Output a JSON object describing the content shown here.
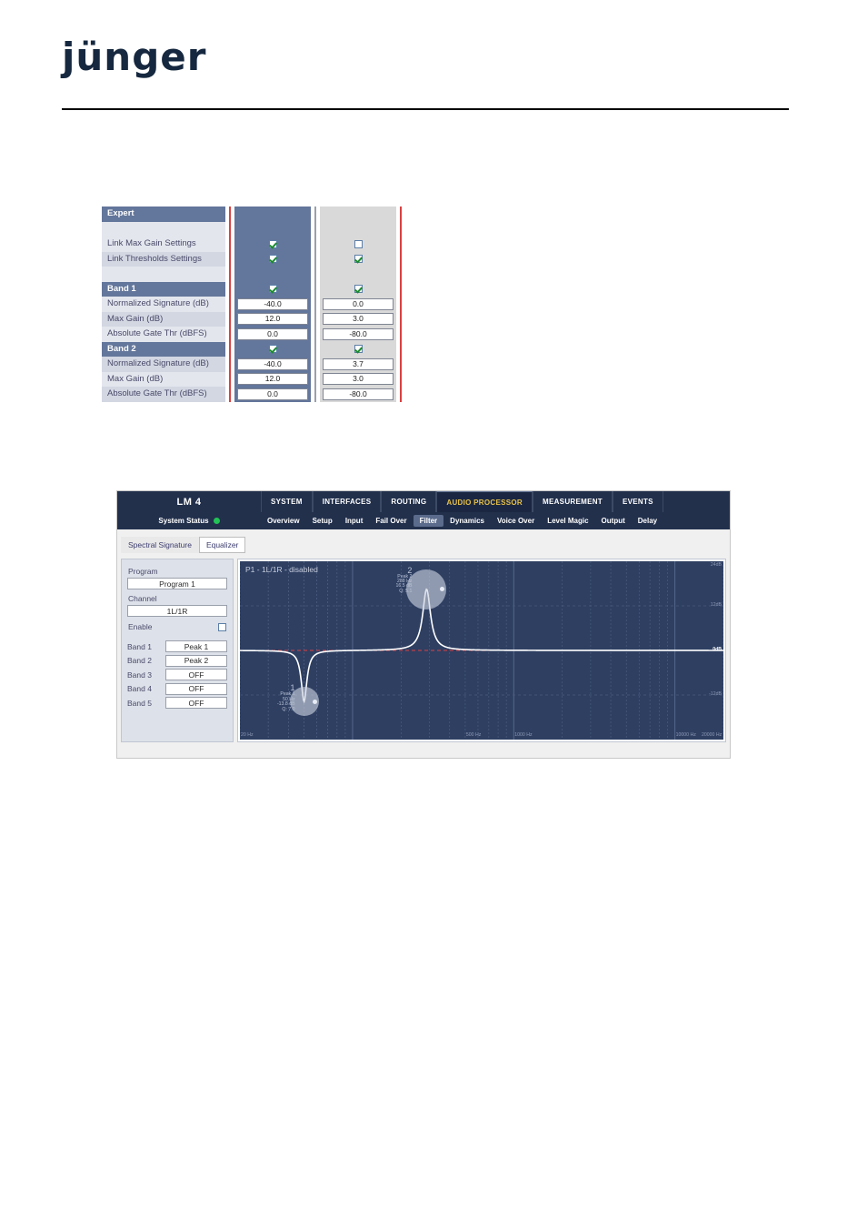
{
  "brand": {
    "logo_text": "jünger"
  },
  "settings_table": {
    "rows": [
      {
        "type": "header",
        "label": "Expert",
        "header_checkbox": true,
        "blue": null,
        "gray": null
      },
      {
        "type": "blank",
        "label": "",
        "blue": null,
        "gray": null
      },
      {
        "type": "check",
        "label": "Link Max Gain Settings",
        "blue": "checked",
        "gray": "unchecked"
      },
      {
        "type": "check",
        "label": "Link Thresholds Settings",
        "blue": "checked",
        "gray": "checked"
      },
      {
        "type": "blank",
        "label": "",
        "blue": null,
        "gray": null
      },
      {
        "type": "header",
        "label": "Band 1",
        "header_checkbox": false,
        "blue": "checked",
        "gray": "checked"
      },
      {
        "type": "value",
        "label": "Normalized Signature (dB)",
        "blue": "-40.0",
        "gray": "0.0"
      },
      {
        "type": "value",
        "label": "Max Gain (dB)",
        "blue": "12.0",
        "gray": "3.0"
      },
      {
        "type": "value",
        "label": "Absolute Gate Thr (dBFS)",
        "blue": "0.0",
        "gray": "-80.0"
      },
      {
        "type": "header",
        "label": "Band 2",
        "header_checkbox": false,
        "blue": "checked",
        "gray": "checked"
      },
      {
        "type": "value",
        "label": "Normalized Signature (dB)",
        "blue": "-40.0",
        "gray": "3.7"
      },
      {
        "type": "value",
        "label": "Max Gain (dB)",
        "blue": "12.0",
        "gray": "3.0"
      },
      {
        "type": "value",
        "label": "Absolute Gate Thr (dBFS)",
        "blue": "0.0",
        "gray": "-80.0"
      }
    ]
  },
  "lm4": {
    "brand": "LM 4",
    "status_label": "System Status",
    "status_color": "#22c455",
    "top_tabs": [
      {
        "label": "SYSTEM",
        "active": false
      },
      {
        "label": "INTERFACES",
        "active": false
      },
      {
        "label": "ROUTING",
        "active": false
      },
      {
        "label": "AUDIO PROCESSOR",
        "active": true
      },
      {
        "label": "MEASUREMENT",
        "active": false
      },
      {
        "label": "EVENTS",
        "active": false
      }
    ],
    "sub_tabs": [
      {
        "label": "Overview",
        "active": false
      },
      {
        "label": "Setup",
        "active": false
      },
      {
        "label": "Input",
        "active": false
      },
      {
        "label": "Fail Over",
        "active": false
      },
      {
        "label": "Filter",
        "active": true
      },
      {
        "label": "Dynamics",
        "active": false
      },
      {
        "label": "Voice Over",
        "active": false
      },
      {
        "label": "Level Magic",
        "active": false
      },
      {
        "label": "Output",
        "active": false
      },
      {
        "label": "Delay",
        "active": false
      }
    ],
    "pills": [
      {
        "label": "Spectral Signature",
        "active": false
      },
      {
        "label": "Equalizer",
        "active": true
      }
    ],
    "panel": {
      "program_label": "Program",
      "program_value": "Program 1",
      "channel_label": "Channel",
      "channel_value": "1L/1R",
      "enable_label": "Enable",
      "enable_checked": false,
      "bands": [
        {
          "name": "Band 1",
          "value": "Peak 1"
        },
        {
          "name": "Band 2",
          "value": "Peak 2"
        },
        {
          "name": "Band 3",
          "value": "OFF"
        },
        {
          "name": "Band 4",
          "value": "OFF"
        },
        {
          "name": "Band 5",
          "value": "OFF"
        }
      ]
    }
  },
  "chart_data": {
    "type": "line",
    "title": "P1 - 1L/1R - disabled",
    "xlabel": "",
    "ylabel": "",
    "xscale": "log",
    "xlim": [
      20,
      20000
    ],
    "ylim": [
      -24,
      24
    ],
    "grid": true,
    "legend": "none",
    "curve_color": "#ffffff",
    "zero_line_color": "#d94141",
    "background": "#2e3f62",
    "x_ticks": [
      "20 Hz",
      "500 Hz",
      "1000 Hz",
      "10000 Hz",
      "20000 Hz"
    ],
    "y_ticks": [
      "24dB",
      "12dB",
      "0dB",
      "-12dB"
    ],
    "markers": [
      {
        "number": "1",
        "type": "Peak 1",
        "freq": "50 Hz",
        "gain": "-13.8 dB",
        "q": "Q: 7.0",
        "freq_hz": 50,
        "gain_db": -13.8,
        "q_value": 7.0
      },
      {
        "number": "2",
        "type": "Peak 2",
        "freq": "288 Hz",
        "gain": "16.5 dB",
        "q": "Q: 5.1",
        "freq_hz": 288,
        "gain_db": 16.5,
        "q_value": 5.1
      }
    ]
  }
}
